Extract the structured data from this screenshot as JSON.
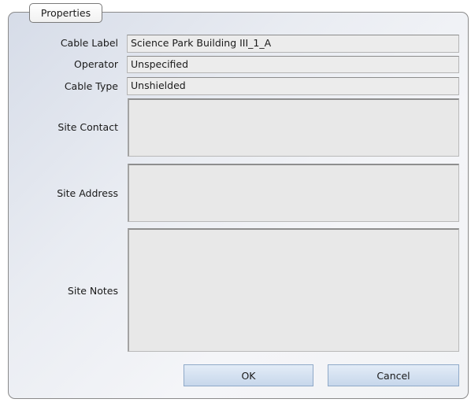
{
  "group_title": "Properties",
  "fields": {
    "cable_label": {
      "label": "Cable Label",
      "value": "Science Park Building III_1_A"
    },
    "operator": {
      "label": "Operator",
      "value": "Unspecified"
    },
    "cable_type": {
      "label": "Cable Type",
      "value": "Unshielded"
    },
    "site_contact": {
      "label": "Site Contact",
      "value": ""
    },
    "site_address": {
      "label": "Site Address",
      "value": ""
    },
    "site_notes": {
      "label": "Site Notes",
      "value": ""
    }
  },
  "buttons": {
    "ok": "OK",
    "cancel": "Cancel"
  }
}
